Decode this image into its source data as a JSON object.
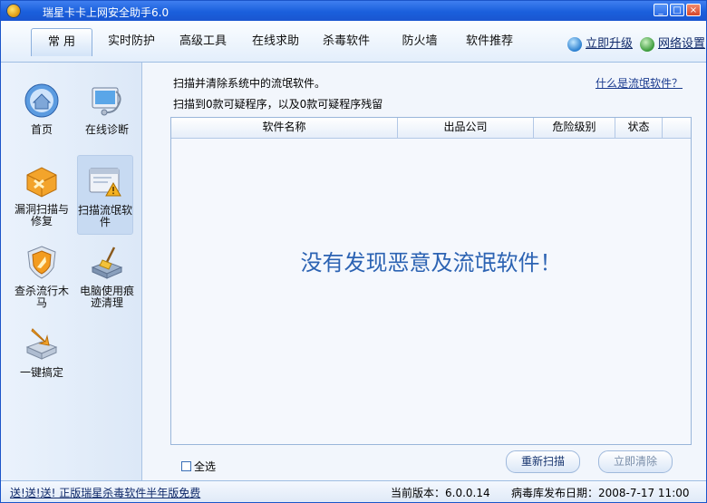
{
  "window": {
    "title": "瑞星卡卡上网安全助手6.0"
  },
  "nav": {
    "tabs": [
      "常 用",
      "实时防护",
      "高级工具",
      "在线求助",
      "杀毒软件",
      "防火墙",
      "软件推荐"
    ],
    "upgrade_label": "立即升级",
    "settings_label": "网络设置"
  },
  "sidebar": {
    "items": [
      {
        "label": "首页",
        "icon": "home-icon"
      },
      {
        "label": "在线诊断",
        "icon": "stethoscope-monitor-icon"
      },
      {
        "label": "漏洞扫描与修复",
        "icon": "repair-box-icon"
      },
      {
        "label": "扫描流氓软件",
        "icon": "warning-window-icon"
      },
      {
        "label": "查杀流行木马",
        "icon": "trojan-shield-icon"
      },
      {
        "label": "电脑使用痕迹清理",
        "icon": "broom-disk-icon"
      },
      {
        "label": "一键搞定",
        "icon": "one-click-icon"
      }
    ],
    "active_index": 3
  },
  "main": {
    "description": "扫描并清除系统中的流氓软件。",
    "summary": "扫描到0款可疑程序，以及0款可疑程序残留",
    "help_link": "什么是流氓软件？",
    "columns": [
      "软件名称",
      "出品公司",
      "危险级别",
      "状态"
    ],
    "empty_message": "没有发现恶意及流氓软件！",
    "select_all_label": "全选",
    "rescan_label": "重新扫描",
    "clear_label": "立即清除"
  },
  "status": {
    "promo": "送!送!送! 正版瑞星杀毒软件半年版免费",
    "version": "当前版本：6.0.0.14",
    "virus_db_date": "病毒库发布日期：2008-7-17 11:00"
  }
}
